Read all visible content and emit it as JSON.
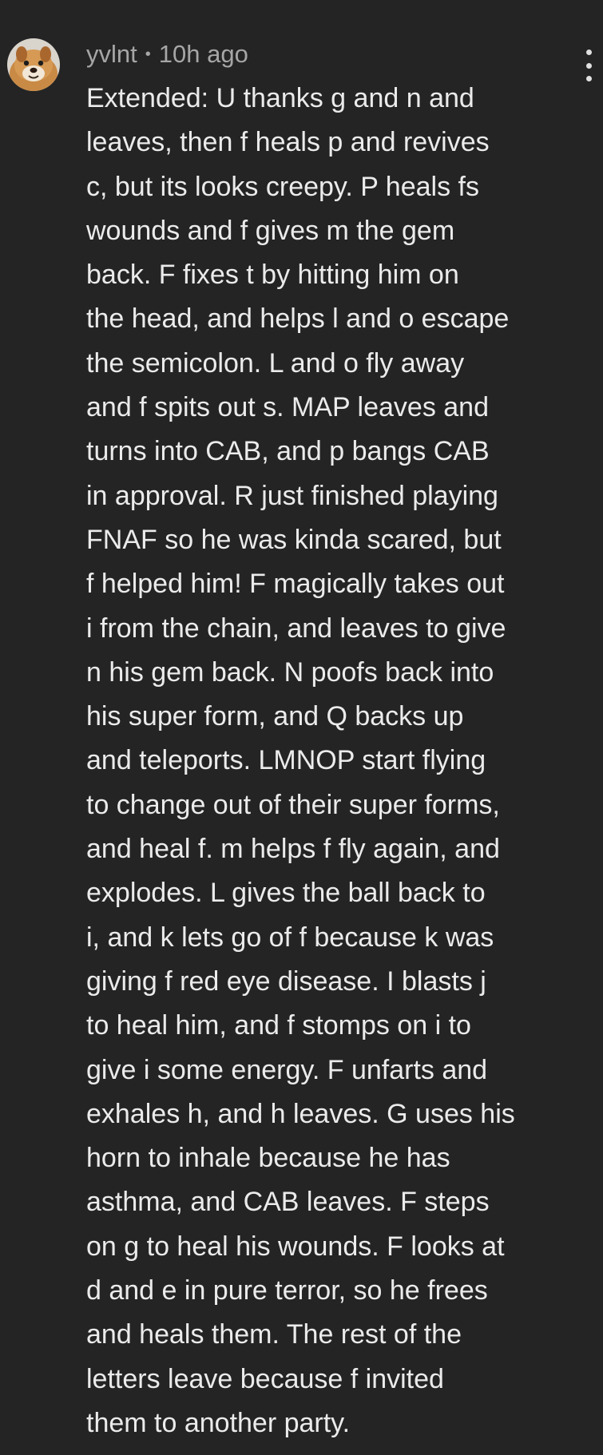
{
  "comment": {
    "author": "yvlnt",
    "separator": "•",
    "timestamp": "10h ago",
    "menu_icon": "more-vertical-icon",
    "avatar_icon": "cartoon-dog-avatar",
    "text_lines": [
      "Extended: U thanks g and n and",
      "leaves, then f heals p and revives",
      "c, but its looks creepy. P heals fs",
      "wounds and f gives m the gem",
      "back. F fixes t by hitting him on",
      "the head, and helps l and o escape",
      "the semicolon. L and o fly away",
      "and f spits out s. MAP leaves and",
      "turns into CAB, and p bangs CAB",
      "in approval. R just finished playing",
      "FNAF so he was kinda scared, but",
      "f helped him! F magically takes out",
      "i from the chain, and leaves to give",
      "n his gem back. N poofs back into",
      "his super form, and Q backs up",
      "and teleports. LMNOP start flying",
      "to change out of their super forms,",
      "and heal f. m helps f fly again, and",
      "explodes. L gives the ball back to",
      "i, and k lets go of f because k was",
      "giving f red eye disease. I blasts j",
      "to heal him, and f stomps on i to",
      "give i some energy. F unfarts and",
      "exhales h, and h leaves. G uses his",
      "horn to inhale because he has",
      "asthma, and CAB leaves. F steps",
      "on g to heal his wounds. F looks at",
      "d and e in pure terror, so he frees",
      "and heals them. The rest of the",
      "letters leave because f invited",
      "them to another party."
    ]
  },
  "colors": {
    "background": "#242424",
    "text": "#ebebeb",
    "meta": "#a6a6a6"
  }
}
